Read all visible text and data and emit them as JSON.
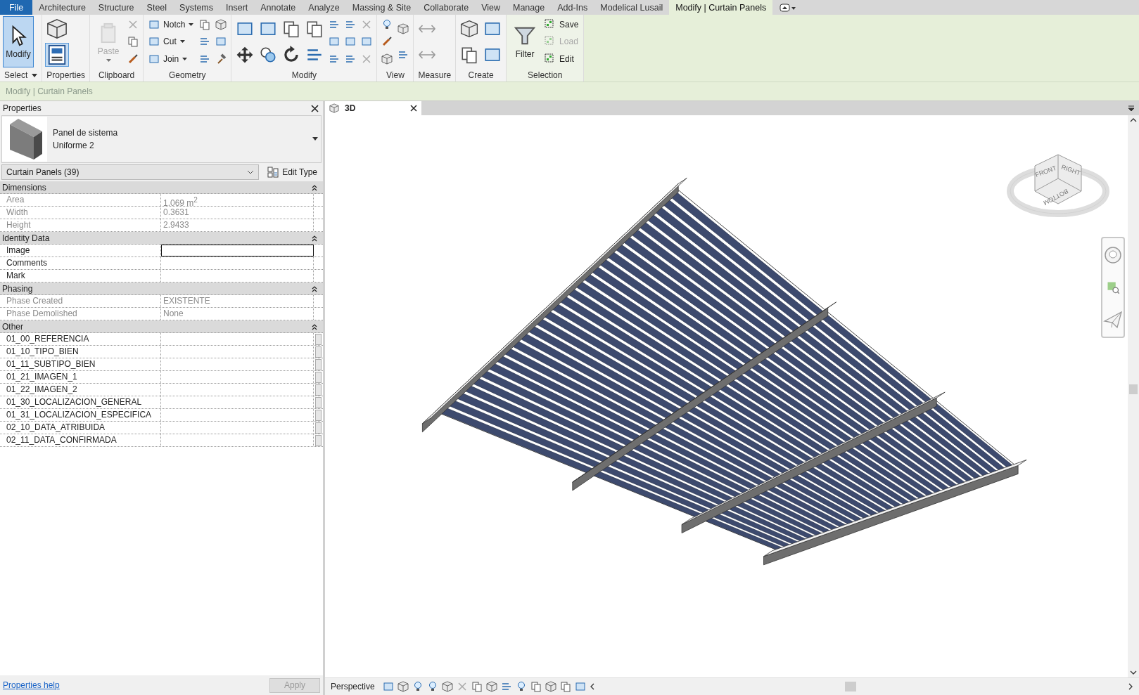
{
  "menu_tabs": [
    {
      "label": "File",
      "kind": "file",
      "selected": false
    },
    {
      "label": "Architecture",
      "kind": "tab",
      "selected": false
    },
    {
      "label": "Structure",
      "kind": "tab",
      "selected": false
    },
    {
      "label": "Steel",
      "kind": "tab",
      "selected": false
    },
    {
      "label": "Systems",
      "kind": "tab",
      "selected": false
    },
    {
      "label": "Insert",
      "kind": "tab",
      "selected": false
    },
    {
      "label": "Annotate",
      "kind": "tab",
      "selected": false
    },
    {
      "label": "Analyze",
      "kind": "tab",
      "selected": false
    },
    {
      "label": "Massing & Site",
      "kind": "tab",
      "selected": false
    },
    {
      "label": "Collaborate",
      "kind": "tab",
      "selected": false
    },
    {
      "label": "View",
      "kind": "tab",
      "selected": false
    },
    {
      "label": "Manage",
      "kind": "tab",
      "selected": false
    },
    {
      "label": "Add-Ins",
      "kind": "tab",
      "selected": false
    },
    {
      "label": "Modelical Lusail",
      "kind": "tab",
      "selected": false
    },
    {
      "label": "Modify | Curtain Panels",
      "kind": "contextual",
      "selected": true
    }
  ],
  "ribbon_panels": [
    {
      "title": "Select",
      "kind": "select",
      "tools": [
        {
          "kind": "large",
          "label": "Modify",
          "selected": true,
          "disabled": false,
          "dropdown": false
        }
      ]
    },
    {
      "title": "Properties",
      "kind": "properties",
      "toggled": true
    },
    {
      "title": "Clipboard",
      "kind": "clipboard",
      "tools": [
        {
          "kind": "large",
          "label": "Paste",
          "selected": false,
          "disabled": true,
          "dropdown": true
        }
      ]
    },
    {
      "title": "Geometry",
      "kind": "geometry",
      "tools": [
        {
          "kind": "small",
          "label": "Notch",
          "disabled": false,
          "dropdown": true
        },
        {
          "kind": "small",
          "label": "Cut",
          "disabled": false,
          "dropdown": true
        },
        {
          "kind": "small",
          "label": "Join",
          "disabled": false,
          "dropdown": true
        }
      ]
    },
    {
      "title": "Modify",
      "kind": "modify"
    },
    {
      "title": "View",
      "kind": "view"
    },
    {
      "title": "Measure",
      "kind": "measure"
    },
    {
      "title": "Create",
      "kind": "create"
    },
    {
      "title": "Selection",
      "kind": "selection",
      "tools": [
        {
          "kind": "large",
          "label": "Filter",
          "selected": false,
          "disabled": false,
          "dropdown": false
        },
        {
          "kind": "small",
          "label": "Save",
          "disabled": false,
          "dropdown": false
        },
        {
          "kind": "small",
          "label": "Load",
          "disabled": true,
          "dropdown": false
        },
        {
          "kind": "small",
          "label": "Edit",
          "disabled": false,
          "dropdown": false
        }
      ]
    }
  ],
  "context_bar": "Modify | Curtain Panels",
  "properties": {
    "title": "Properties",
    "type_family": "Panel de sistema",
    "type_name": "Uniforme 2",
    "category_filter": "Curtain Panels (39)",
    "edit_type": "Edit Type",
    "groups": [
      {
        "name": "Dimensions",
        "expanded": true,
        "rows": [
          {
            "label": "Area",
            "value": "1.069 m$^{2}$",
            "readonly": true,
            "focused": false,
            "button": false
          },
          {
            "label": "Width",
            "value": "0.3631",
            "readonly": true,
            "focused": false,
            "button": false
          },
          {
            "label": "Height",
            "value": "2.9433",
            "readonly": true,
            "focused": false,
            "button": false
          }
        ]
      },
      {
        "name": "Identity Data",
        "expanded": true,
        "rows": [
          {
            "label": "Image",
            "readonly": false,
            "focused": true,
            "button": false
          },
          {
            "label": "Comments",
            "readonly": false,
            "focused": false,
            "button": false
          },
          {
            "label": "Mark",
            "readonly": false,
            "focused": false,
            "button": false
          }
        ]
      },
      {
        "name": "Phasing",
        "expanded": true,
        "rows": [
          {
            "label": "Phase Created",
            "value": "EXISTENTE",
            "readonly": true,
            "focused": false,
            "button": false
          },
          {
            "label": "Phase Demolished",
            "value": "None",
            "readonly": true,
            "focused": false,
            "button": false
          }
        ]
      },
      {
        "name": "Other",
        "expanded": true,
        "rows": [
          {
            "label": "01_00_REFERENCIA",
            "readonly": false,
            "focused": false,
            "button": true
          },
          {
            "label": "01_10_TIPO_BIEN",
            "readonly": false,
            "focused": false,
            "button": true
          },
          {
            "label": "01_11_SUBTIPO_BIEN",
            "readonly": false,
            "focused": false,
            "button": true
          },
          {
            "label": "01_21_IMAGEN_1",
            "readonly": false,
            "focused": false,
            "button": true
          },
          {
            "label": "01_22_IMAGEN_2",
            "readonly": false,
            "focused": false,
            "button": true
          },
          {
            "label": "01_30_LOCALIZACION_GENERAL",
            "readonly": false,
            "focused": false,
            "button": true
          },
          {
            "label": "01_31_LOCALIZACION_ESPECIFICA",
            "readonly": false,
            "focused": false,
            "button": true
          },
          {
            "label": "02_10_DATA_ATRIBUIDA",
            "readonly": false,
            "focused": false,
            "button": true
          },
          {
            "label": "02_11_DATA_CONFIRMADA",
            "readonly": false,
            "focused": false,
            "button": true
          }
        ]
      }
    ],
    "help_link": "Properties help",
    "apply": {
      "label": "Apply",
      "disabled": true
    }
  },
  "view_tabs": [
    {
      "label": "3D",
      "selected": true
    }
  ],
  "view_cube": {
    "faces": [
      "FRONT",
      "RIGHT",
      "BOTTOM"
    ]
  },
  "view_bar": {
    "projection": "Perspective"
  }
}
